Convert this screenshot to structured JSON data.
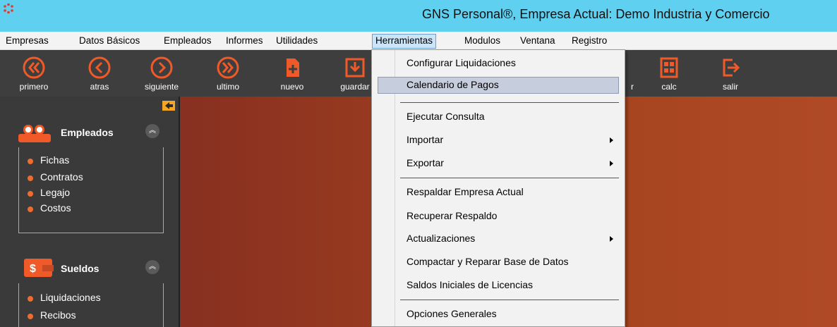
{
  "window": {
    "title": "GNS Personal®, Empresa Actual: Demo Industria y Comercio"
  },
  "menubar": {
    "items": [
      {
        "label": "Empresas"
      },
      {
        "label": "Datos Básicos"
      },
      {
        "label": "Empleados"
      },
      {
        "label": "Informes"
      },
      {
        "label": "Utilidades"
      },
      {
        "label": "Herramientas"
      },
      {
        "label": "Modulos"
      },
      {
        "label": "Ventana"
      },
      {
        "label": "Registro"
      }
    ]
  },
  "toolbar": {
    "buttons": [
      {
        "label": "primero",
        "icon": "double-chevron-left-icon"
      },
      {
        "label": "atras",
        "icon": "chevron-left-icon"
      },
      {
        "label": "siguiente",
        "icon": "chevron-right-icon"
      },
      {
        "label": "ultimo",
        "icon": "double-chevron-right-icon"
      },
      {
        "label": "nuevo",
        "icon": "new-document-icon"
      },
      {
        "label": "guardar",
        "icon": "save-icon"
      },
      {
        "label": "r",
        "icon": "hidden-icon"
      },
      {
        "label": "calc",
        "icon": "calculator-icon"
      },
      {
        "label": "salir",
        "icon": "exit-icon"
      }
    ],
    "icon_color": "#f05a28"
  },
  "sidebar": {
    "groups": [
      {
        "title": "Empleados",
        "icon": "people-icon",
        "items": [
          "Fichas",
          "Contratos",
          "Legajo",
          "Costos"
        ]
      },
      {
        "title": "Sueldos",
        "icon": "wallet-icon",
        "items": [
          "Liquidaciones",
          "Recibos"
        ]
      }
    ]
  },
  "dropdown": {
    "items": [
      {
        "label": "Configurar Liquidaciones"
      },
      {
        "label": "Calendario de Pagos"
      },
      {
        "label": "Ejecutar Consulta"
      },
      {
        "label": "Importar"
      },
      {
        "label": "Exportar"
      },
      {
        "label": "Respaldar Empresa Actual"
      },
      {
        "label": "Recuperar Respaldo"
      },
      {
        "label": "Actualizaciones"
      },
      {
        "label": "Compactar y Reparar  Base de Datos"
      },
      {
        "label": "Saldos Iniciales de Licencias"
      },
      {
        "label": "Opciones Generales"
      }
    ]
  }
}
